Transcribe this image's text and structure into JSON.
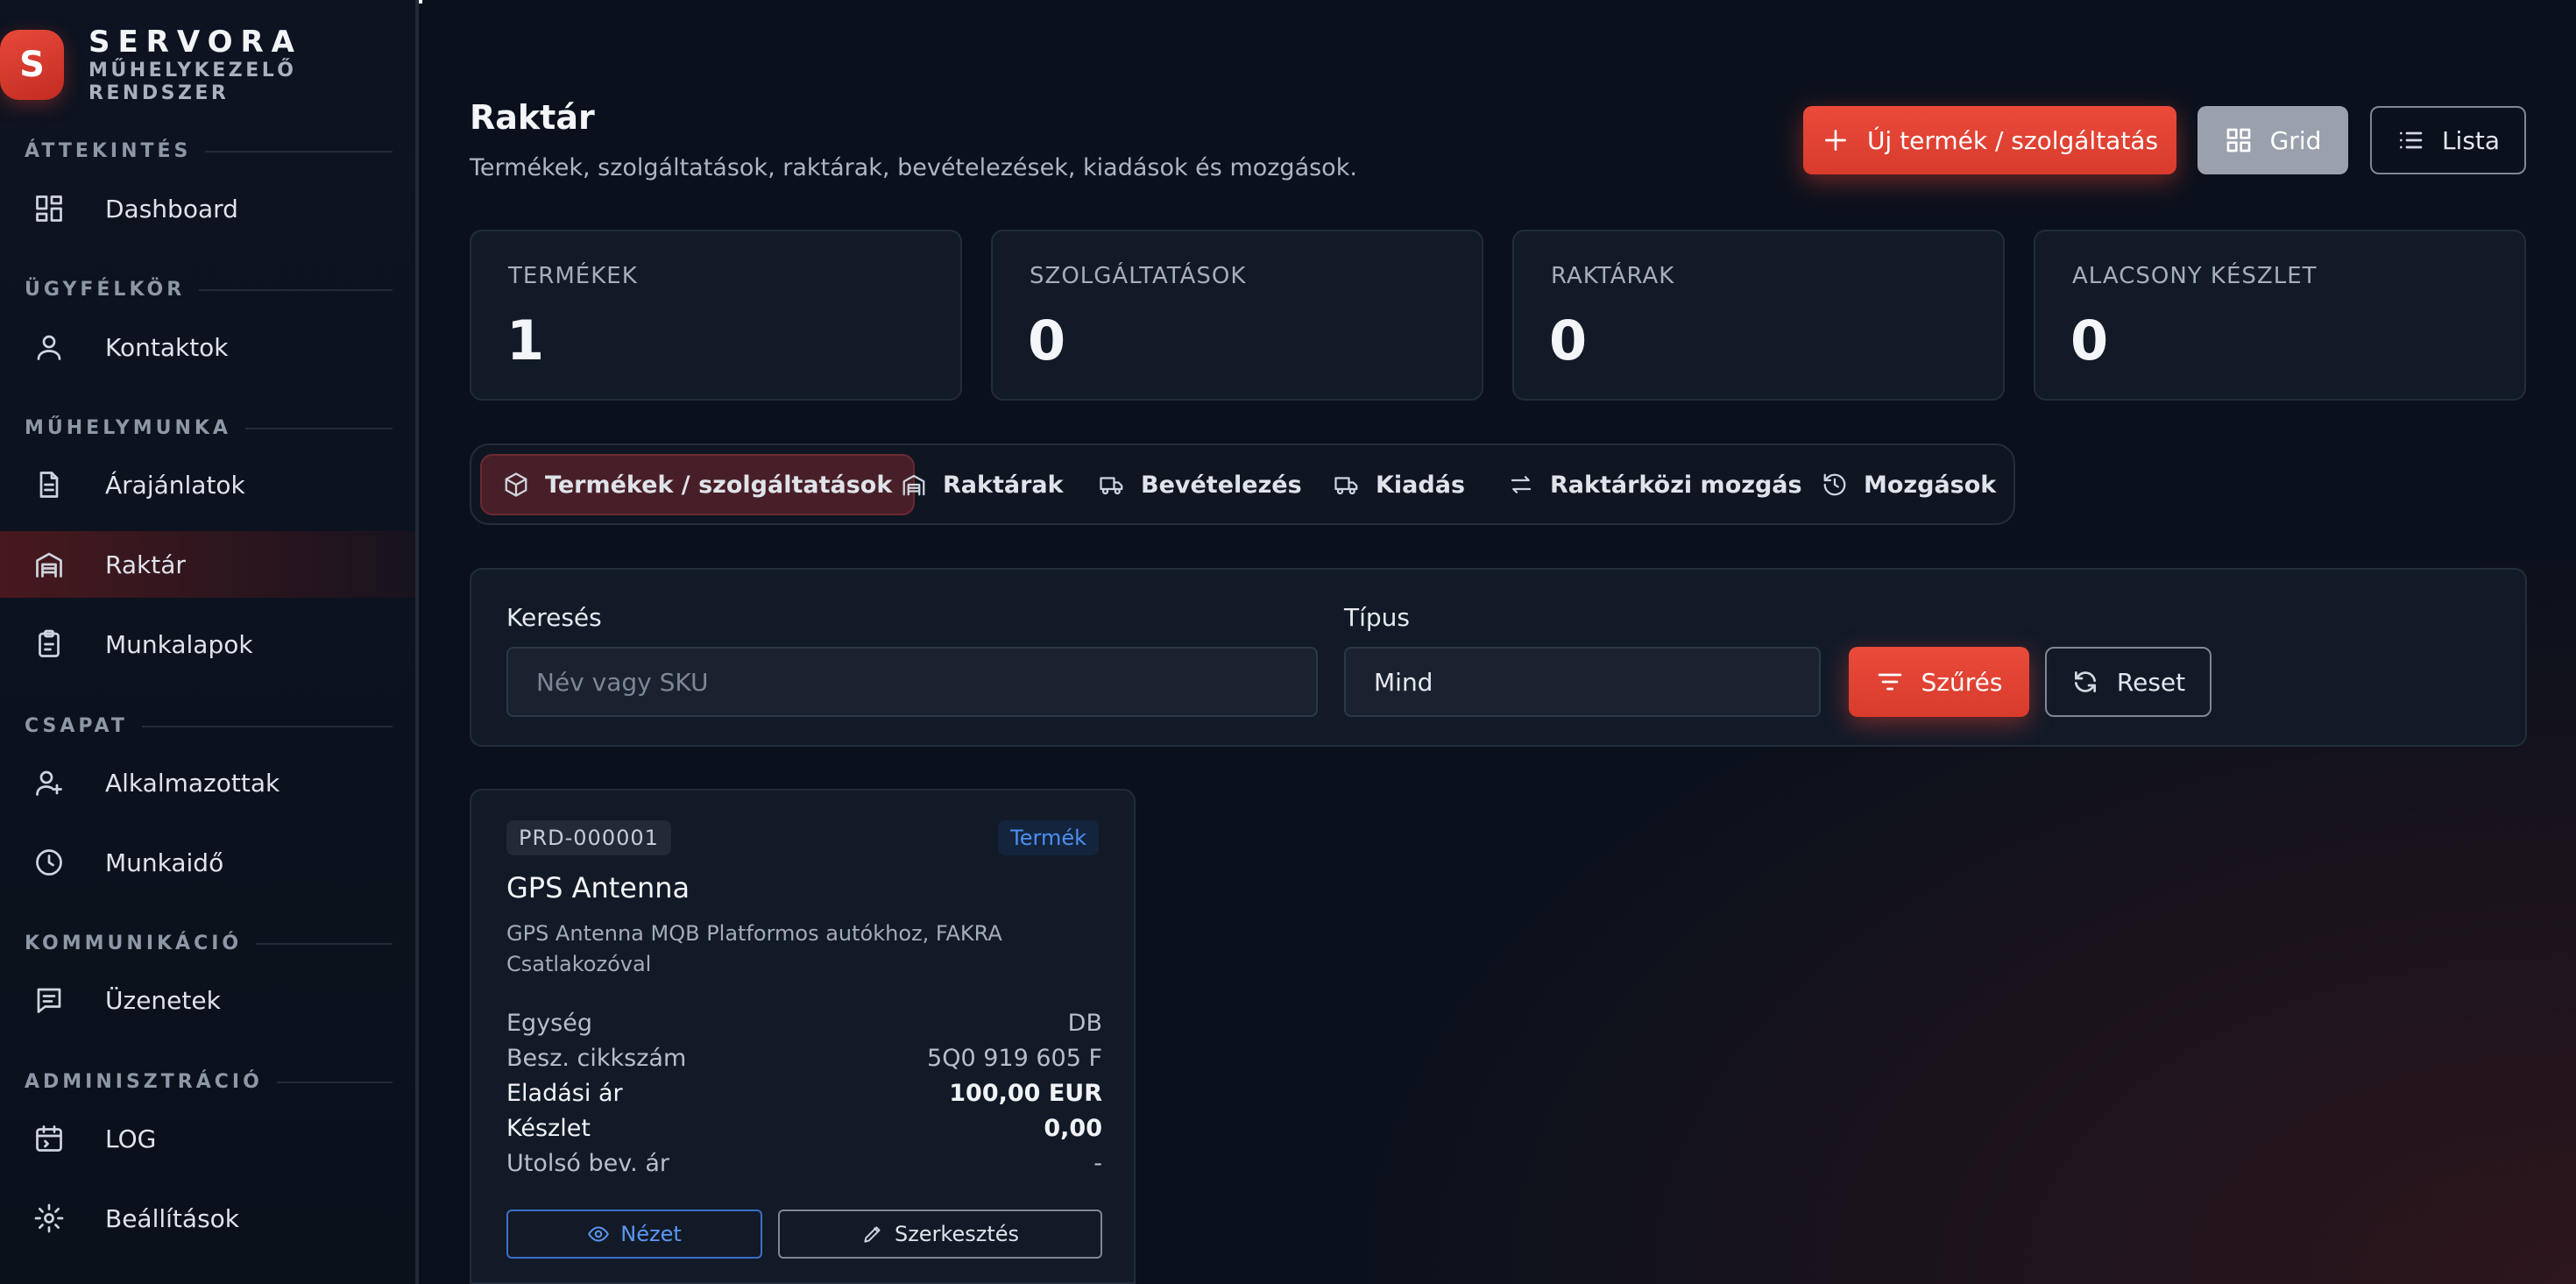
{
  "brand": {
    "logo_letter": "S",
    "name": "SERVORA",
    "subtitle": "MŰHELYKEZELŐ RENDSZER"
  },
  "sidebar": {
    "sections": [
      {
        "label": "ÁTTEKINTÉS",
        "items": [
          {
            "label": "Dashboard",
            "icon": "dashboard-icon"
          }
        ]
      },
      {
        "label": "ÜGYFÉLKÖR",
        "items": [
          {
            "label": "Kontaktok",
            "icon": "user-icon"
          }
        ]
      },
      {
        "label": "MŰHELYMUNKA",
        "items": [
          {
            "label": "Árajánlatok",
            "icon": "document-icon"
          },
          {
            "label": "Raktár",
            "icon": "warehouse-icon",
            "active": true
          },
          {
            "label": "Munkalapok",
            "icon": "clipboard-icon"
          }
        ]
      },
      {
        "label": "CSAPAT",
        "items": [
          {
            "label": "Alkalmazottak",
            "icon": "user-plus-icon"
          },
          {
            "label": "Munkaidő",
            "icon": "clock-icon"
          }
        ]
      },
      {
        "label": "KOMMUNIKÁCIÓ",
        "items": [
          {
            "label": "Üzenetek",
            "icon": "message-icon"
          }
        ]
      },
      {
        "label": "ADMINISZTRÁCIÓ",
        "items": [
          {
            "label": "LOG",
            "icon": "calendar-log-icon"
          },
          {
            "label": "Beállítások",
            "icon": "gear-icon"
          }
        ]
      }
    ]
  },
  "header": {
    "title": "Raktár",
    "subtitle": "Termékek, szolgáltatások, raktárak, bevételezések, kiadások és mozgások.",
    "new_button": "Új termék / szolgáltatás",
    "grid_button": "Grid",
    "list_button": "Lista"
  },
  "stats": [
    {
      "label": "TERMÉKEK",
      "value": "1"
    },
    {
      "label": "SZOLGÁLTATÁSOK",
      "value": "0"
    },
    {
      "label": "RAKTÁRAK",
      "value": "0"
    },
    {
      "label": "ALACSONY KÉSZLET",
      "value": "0"
    }
  ],
  "tabs": [
    {
      "label": "Termékek / szolgáltatások",
      "icon": "box-icon",
      "active": true
    },
    {
      "label": "Raktárak",
      "icon": "warehouse-icon"
    },
    {
      "label": "Bevételezés",
      "icon": "truck-in-icon"
    },
    {
      "label": "Kiadás",
      "icon": "truck-out-icon"
    },
    {
      "label": "Raktárközi mozgás",
      "icon": "arrows-swap-icon"
    },
    {
      "label": "Mozgások",
      "icon": "history-icon"
    }
  ],
  "filter": {
    "search_label": "Keresés",
    "search_placeholder": "Név vagy SKU",
    "type_label": "Típus",
    "type_value": "Mind",
    "filter_button": "Szűrés",
    "reset_button": "Reset"
  },
  "products": [
    {
      "sku": "PRD-000001",
      "type": "Termék",
      "name": "GPS Antenna",
      "description": "GPS Antenna MQB Platformos autókhoz, FAKRA Csatlakozóval",
      "rows": [
        {
          "label": "Egység",
          "value": "DB"
        },
        {
          "label": "Besz. cikkszám",
          "value": "5Q0 919 605 F"
        },
        {
          "label": "Eladási ár",
          "value": "100,00 EUR"
        },
        {
          "label": "Készlet",
          "value": "0,00"
        },
        {
          "label": "Utolsó bev. ár",
          "value": "-"
        }
      ],
      "view_button": "Nézet",
      "edit_button": "Szerkesztés"
    }
  ],
  "colors": {
    "accent": "#e5453a",
    "link": "#4e8ef0",
    "background": "#0b111c"
  }
}
